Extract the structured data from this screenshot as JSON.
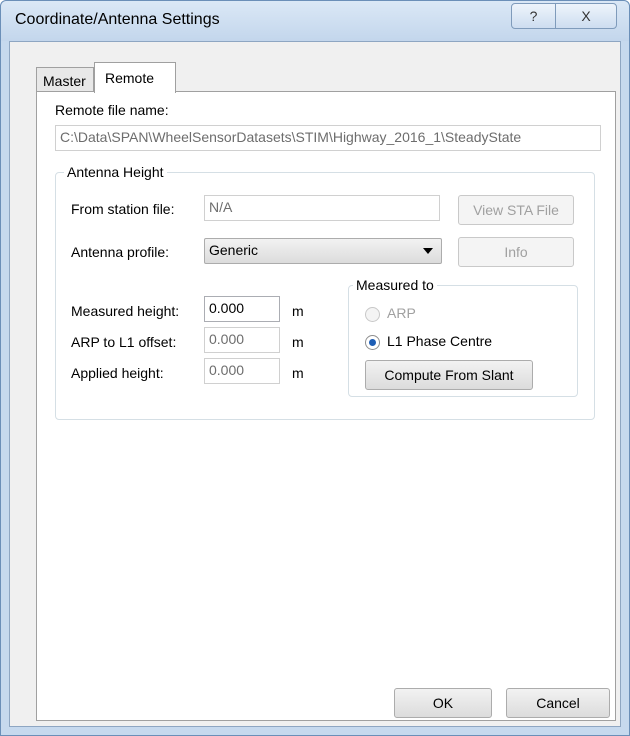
{
  "window": {
    "title": "Coordinate/Antenna Settings",
    "help_label": "?",
    "close_label": "X"
  },
  "tabs": [
    {
      "label": "Master",
      "selected": false
    },
    {
      "label": "Remote",
      "selected": true
    }
  ],
  "remote": {
    "file_label": "Remote file name:",
    "file_value": "C:\\Data\\SPAN\\WheelSensorDatasets\\STIM\\Highway_2016_1\\SteadyState"
  },
  "antenna": {
    "group_title": "Antenna Height",
    "station_label": "From station file:",
    "station_value": "N/A",
    "view_sta_button": "View STA File",
    "profile_label": "Antenna profile:",
    "profile_value": "Generic",
    "info_button": "Info",
    "measured_height_label": "Measured height:",
    "measured_height_value": "0.000",
    "arp_offset_label": "ARP to L1 offset:",
    "arp_offset_value": "0.000",
    "applied_height_label": "Applied height:",
    "applied_height_value": "0.000",
    "unit": "m"
  },
  "measured_to": {
    "group_title": "Measured to",
    "option_arp": "ARP",
    "option_l1": "L1 Phase Centre",
    "selected": "L1 Phase Centre",
    "compute_button": "Compute From Slant"
  },
  "footer": {
    "ok_button": "OK",
    "cancel_button": "Cancel"
  }
}
